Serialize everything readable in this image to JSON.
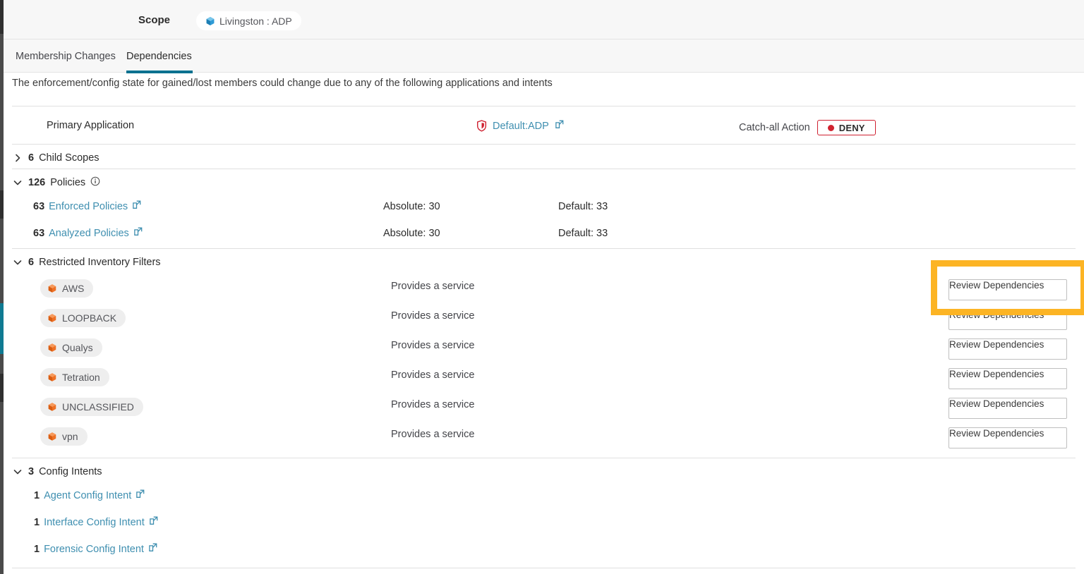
{
  "header": {
    "scope_label": "Scope",
    "scope_chip": {
      "text": "Livingston : ADP",
      "icon": "cube-icon",
      "icon_color": "#2f9bd6"
    }
  },
  "tabs": [
    {
      "label": "Membership Changes",
      "active": false
    },
    {
      "label": "Dependencies",
      "active": true
    }
  ],
  "description": "The enforcement/config state for gained/lost members could change due to any of the following applications and intents",
  "primary_application": {
    "label": "Primary Application",
    "link_text": "Default:ADP",
    "link_icon": "external-link-icon",
    "shield_icon": "shield-icon",
    "catch_all_label": "Catch-all Action",
    "catch_all_value": "DENY",
    "catch_all_color": "#d0232f"
  },
  "sections": {
    "child_scopes": {
      "count": "6",
      "label": "Child Scopes",
      "expanded": false
    },
    "policies": {
      "count": "126",
      "label": "Policies",
      "expanded": true,
      "info_icon": "info-circle-icon",
      "rows": [
        {
          "count": "63",
          "link": "Enforced Policies",
          "absolute": "Absolute: 30",
          "default": "Default: 33"
        },
        {
          "count": "63",
          "link": "Analyzed Policies",
          "absolute": "Absolute: 30",
          "default": "Default: 33"
        }
      ]
    },
    "restricted_inventory_filters": {
      "count": "6",
      "label": "Restricted Inventory Filters",
      "expanded": true,
      "button_label": "Review Dependencies",
      "rows": [
        {
          "name": "AWS",
          "service": "Provides a service",
          "icon": "cube-icon"
        },
        {
          "name": "LOOPBACK",
          "service": "Provides a service",
          "icon": "cube-icon"
        },
        {
          "name": "Qualys",
          "service": "Provides a service",
          "icon": "cube-icon"
        },
        {
          "name": "Tetration",
          "service": "Provides a service",
          "icon": "cube-icon"
        },
        {
          "name": "UNCLASSIFIED",
          "service": "Provides a service",
          "icon": "cube-icon"
        },
        {
          "name": "vpn",
          "service": "Provides a service",
          "icon": "cube-icon"
        }
      ]
    },
    "config_intents": {
      "count": "3",
      "label": "Config Intents",
      "expanded": true,
      "rows": [
        {
          "count": "1",
          "link": "Agent Config Intent"
        },
        {
          "count": "1",
          "link": "Interface Config Intent"
        },
        {
          "count": "1",
          "link": "Forensic Config Intent"
        }
      ]
    }
  },
  "colors": {
    "accent_tab": "#00718f",
    "link": "#3f8fb0",
    "chip_icon": "#ee7126",
    "highlight_ring": "#fcb424",
    "deny": "#d0232f"
  }
}
